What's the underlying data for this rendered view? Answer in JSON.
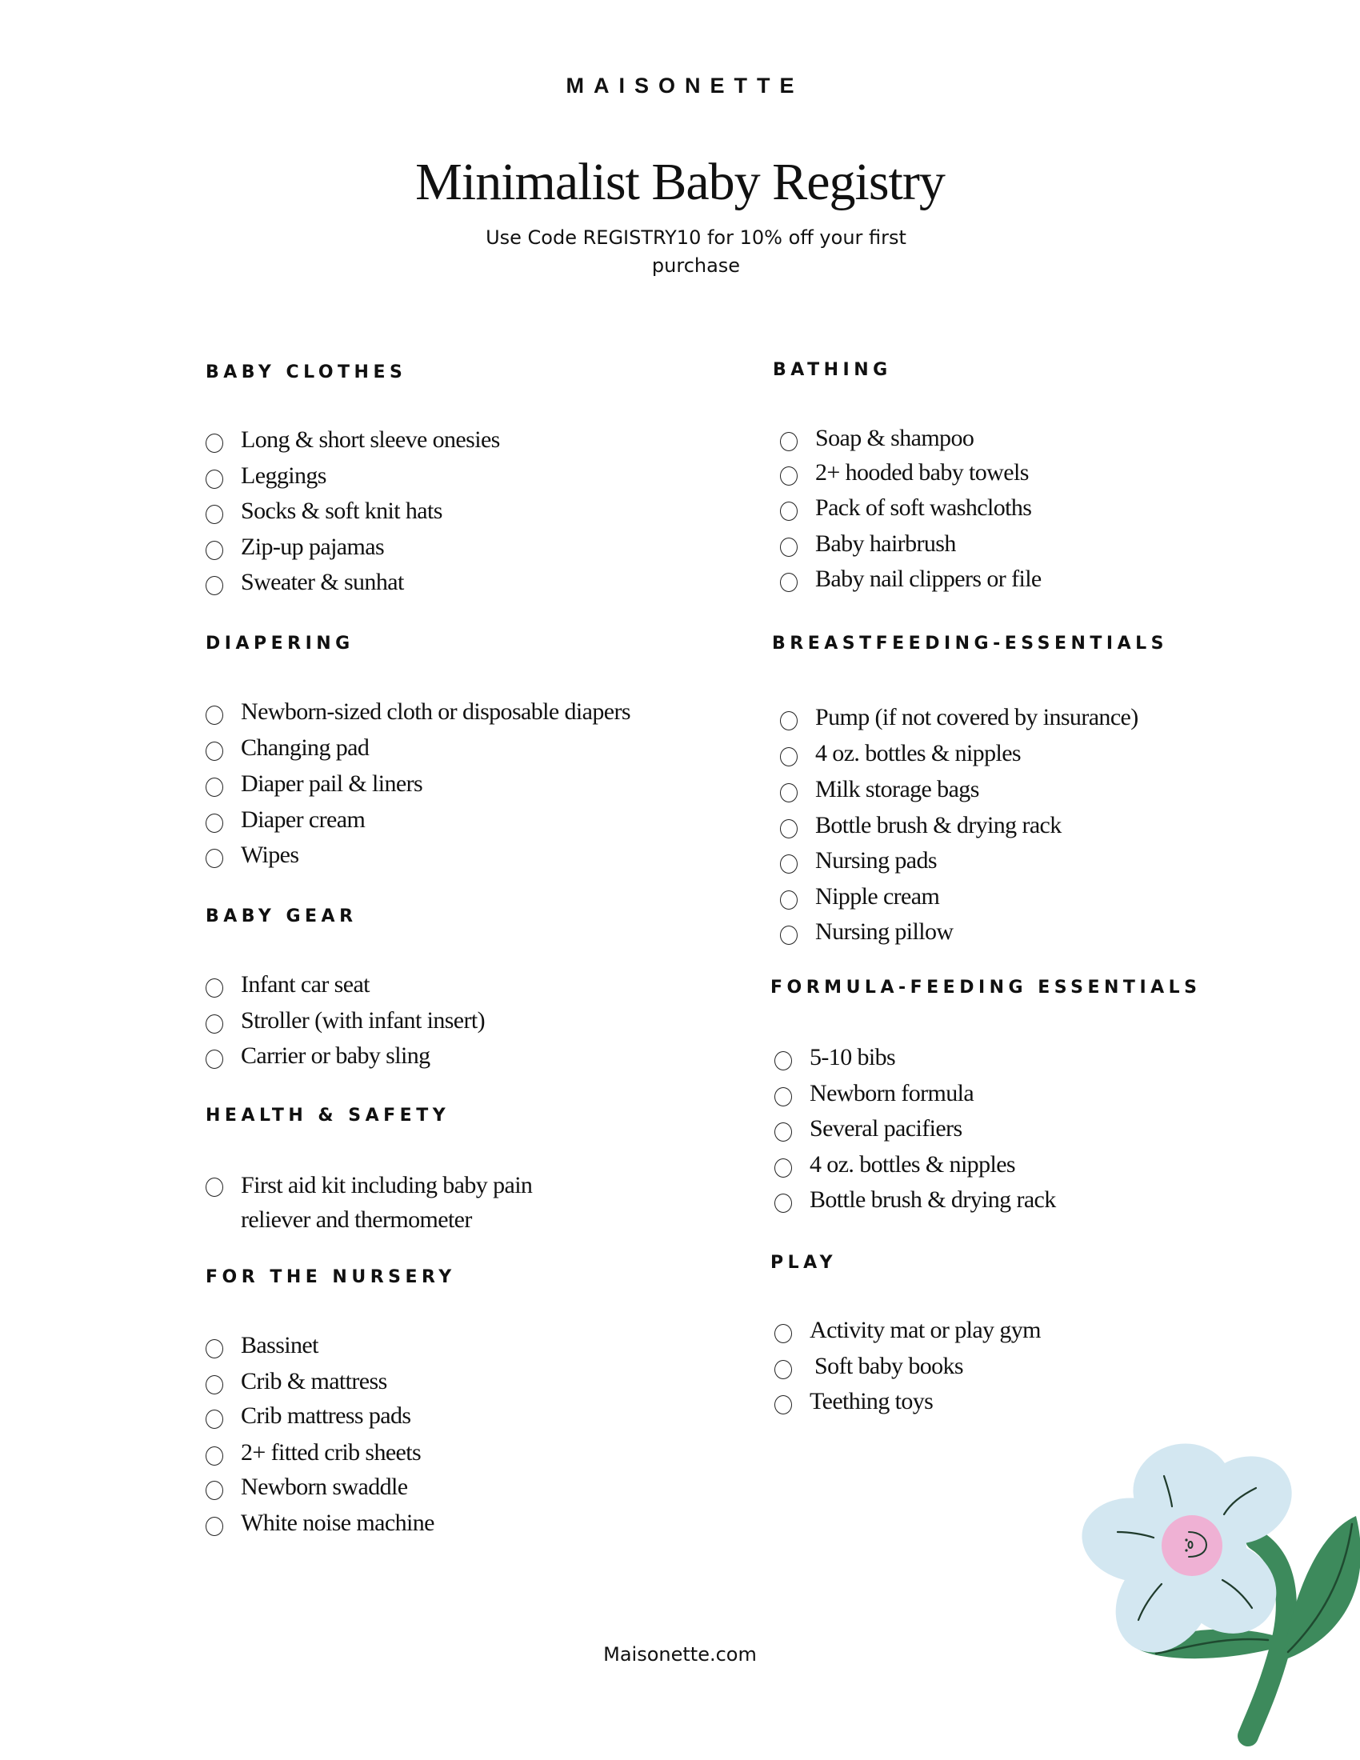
{
  "brand": "MAISONETTE",
  "title": "Minimalist Baby Registry",
  "subtitle": "Use Code REGISTRY10 for 10% off your first purchase",
  "promo_code": "REGISTRY10",
  "footer": "Maisonette.com",
  "colors": {
    "petal": "#d3e7f1",
    "center": "#efb1d4",
    "leaf": "#3d8a5c",
    "ink": "#111111"
  },
  "illustration": "flower-with-smiling-face",
  "left_column": [
    {
      "heading": "BABY CLOTHES",
      "items": [
        "Long & short sleeve onesies",
        "Leggings",
        "Socks & soft knit hats",
        "Zip-up pajamas",
        "Sweater & sunhat"
      ]
    },
    {
      "heading": "DIAPERING",
      "items": [
        "Newborn-sized cloth or disposable diapers",
        "Changing pad",
        "Diaper pail & liners",
        "Diaper cream",
        "Wipes"
      ]
    },
    {
      "heading": "BABY GEAR",
      "items": [
        "Infant car seat",
        "Stroller (with infant insert)",
        "Carrier or baby sling"
      ]
    },
    {
      "heading": "HEALTH & SAFETY",
      "items": [
        "First aid kit including baby pain reliever and thermometer"
      ]
    },
    {
      "heading": "FOR THE NURSERY",
      "items": [
        "Bassinet",
        "Crib & mattress",
        "Crib mattress pads",
        "2+ fitted crib sheets",
        "Newborn swaddle",
        "White noise machine"
      ]
    }
  ],
  "right_column": [
    {
      "heading": "BATHING",
      "items": [
        "Soap & shampoo",
        "2+ hooded baby towels",
        "Pack of soft washcloths",
        "Baby hairbrush",
        "Baby nail clippers or file"
      ]
    },
    {
      "heading": "BREASTFEEDING-ESSENTIALS",
      "items": [
        "Pump (if not covered by insurance)",
        "4 oz. bottles & nipples",
        "Milk storage bags",
        "Bottle brush & drying rack",
        "Nursing pads",
        "Nipple cream",
        "Nursing pillow"
      ]
    },
    {
      "heading": "FORMULA-FEEDING ESSENTIALS",
      "items": [
        "5-10 bibs",
        "Newborn formula",
        "Several pacifiers",
        "4 oz. bottles & nipples",
        "Bottle brush & drying rack"
      ]
    },
    {
      "heading": "PLAY",
      "items": [
        "Activity mat or play gym",
        "Soft baby books",
        "Teething toys"
      ]
    }
  ]
}
